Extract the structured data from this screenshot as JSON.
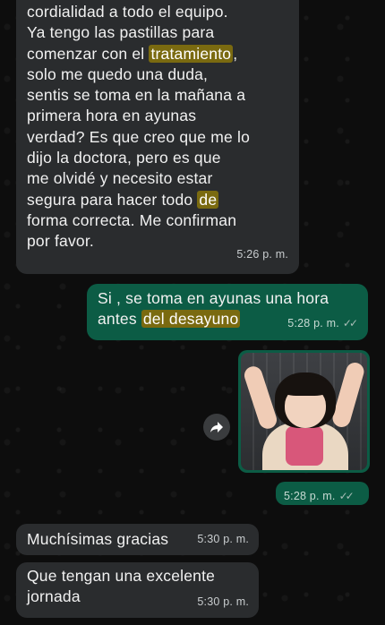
{
  "messages": {
    "m1": {
      "lines": [
        "cordialidad  a todo  el equipo.",
        "Ya  tengo las pastillas  para",
        "comenzar con el ",
        "tratamiento",
        ",",
        "solo  me  quedo  una duda,",
        "sentis  se  toma  en la mañana  a",
        "primera  hora  en  ayunas",
        "verdad?  Es  que  creo que me  lo",
        "dijo la  doctora,  pero    es  que",
        "me olvidé    y  necesito estar",
        "segura  para hacer   todo ",
        "de",
        "forma  correcta. Me  confirman",
        "por favor."
      ],
      "time": "5:26 p. m."
    },
    "m2": {
      "line1": "Si , se toma en ayunas una hora",
      "line2_pre": "antes ",
      "line2_hl": "del desayuno",
      "time": "5:28 p. m."
    },
    "m3": {
      "image_description": "sticker-girl",
      "time": "5:28 p. m."
    },
    "m4": {
      "text": "Muchísimas gracias",
      "time": "5:30 p. m."
    },
    "m5": {
      "line1": "Que  tengan  una excelente",
      "line2": "jornada",
      "time": "5:30 p. m."
    }
  },
  "icons": {
    "forward": "forward-arrow-icon",
    "read_receipt": "double-check-icon"
  },
  "colors": {
    "background": "#0b0b0b",
    "incoming_bubble": "#2a2c2e",
    "outgoing_bubble": "#0c5c45",
    "highlight": "#7a6a10"
  }
}
